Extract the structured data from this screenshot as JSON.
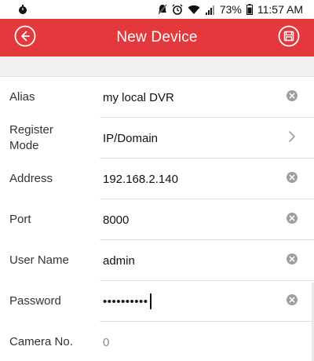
{
  "status_bar": {
    "battery_percent": "73%",
    "time": "11:57 AM"
  },
  "header": {
    "title": "New Device",
    "back_icon": "back-arrow-circle-icon",
    "save_icon": "save-disk-icon"
  },
  "form": {
    "alias": {
      "label": "Alias",
      "value": "my local DVR"
    },
    "register_mode": {
      "label": "Register\nMode",
      "value": "IP/Domain"
    },
    "address": {
      "label": "Address",
      "value": "192.168.2.140"
    },
    "port": {
      "label": "Port",
      "value": "8000"
    },
    "user_name": {
      "label": "User Name",
      "value": "admin"
    },
    "password": {
      "label": "Password",
      "value": "••••••••••"
    },
    "camera_no": {
      "label": "Camera No.",
      "value": "0"
    }
  },
  "colors": {
    "accent": "#e4393c",
    "section_gap": "#f0f0f0",
    "clear_icon": "#9e9e9e"
  }
}
